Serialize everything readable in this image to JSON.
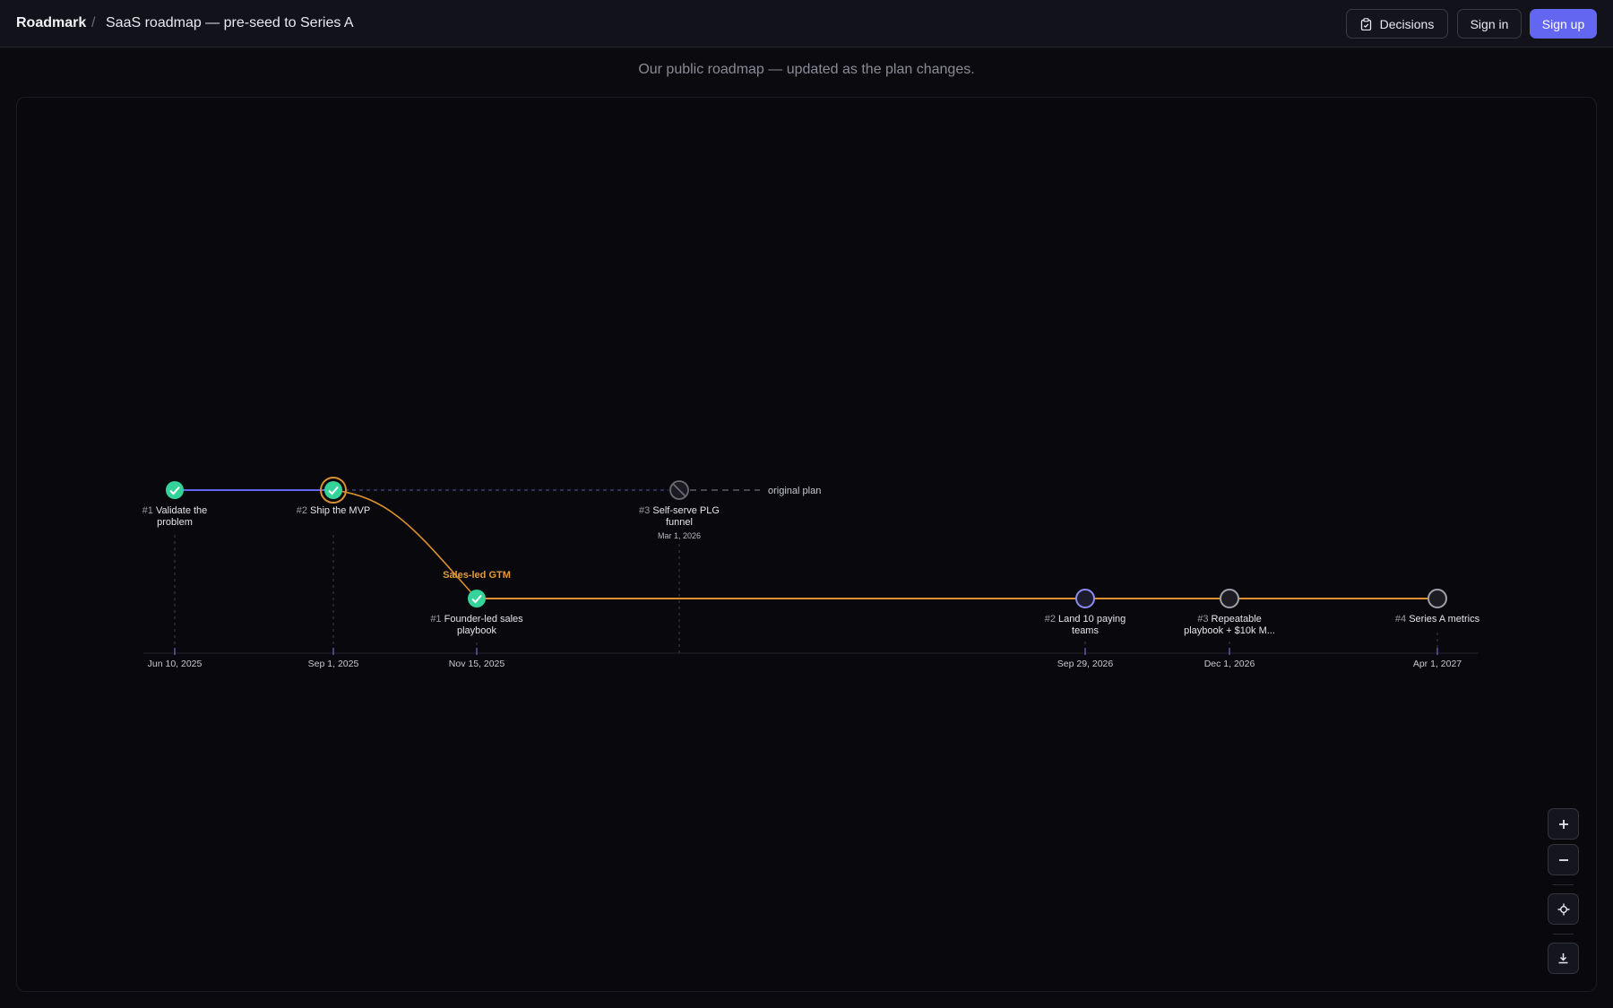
{
  "header": {
    "brand": "Roadmark",
    "separator": "/",
    "title": "SaaS roadmap — pre-seed to Series A",
    "decisions_label": "Decisions",
    "signin_label": "Sign in",
    "signup_label": "Sign up"
  },
  "subtitle": "Our public roadmap — updated as the plan changes.",
  "roadmap": {
    "main_track": [
      {
        "num": "#1",
        "label_lines": [
          "Validate the",
          "problem"
        ],
        "status": "done"
      },
      {
        "num": "#2",
        "label_lines": [
          "Ship the MVP"
        ],
        "status": "done-highlighted"
      }
    ],
    "abandoned": {
      "num": "#3",
      "label_lines": [
        "Self-serve PLG",
        "funnel"
      ],
      "date": "Mar 1, 2026",
      "status": "cancelled",
      "note": "original plan"
    },
    "branch": {
      "name": "Sales-led GTM",
      "nodes": [
        {
          "num": "#1",
          "label_lines": [
            "Founder-led sales",
            "playbook"
          ],
          "status": "done"
        },
        {
          "num": "#2",
          "label_lines": [
            "Land 10 paying",
            "teams"
          ],
          "status": "in-progress"
        },
        {
          "num": "#3",
          "label_lines": [
            "Repeatable",
            "playbook + $10k M..."
          ],
          "status": "planned"
        },
        {
          "num": "#4",
          "label_lines": [
            "Series A metrics"
          ],
          "status": "planned"
        }
      ]
    },
    "axis_dates": [
      "Jun 10, 2025",
      "Sep 1, 2025",
      "Nov 15, 2025",
      "Sep 29, 2026",
      "Dec 1, 2026",
      "Apr 1, 2027"
    ],
    "colors": {
      "done": "#34d399",
      "main_line": "#6366f1",
      "branch_line": "#d9912f",
      "planned": "#9ca3af",
      "in_progress": "#8b8cf5"
    }
  },
  "controls": {
    "zoom_in_icon": "plus-icon",
    "zoom_out_icon": "minus-icon",
    "recenter_icon": "crosshair-icon",
    "download_icon": "download-icon"
  }
}
